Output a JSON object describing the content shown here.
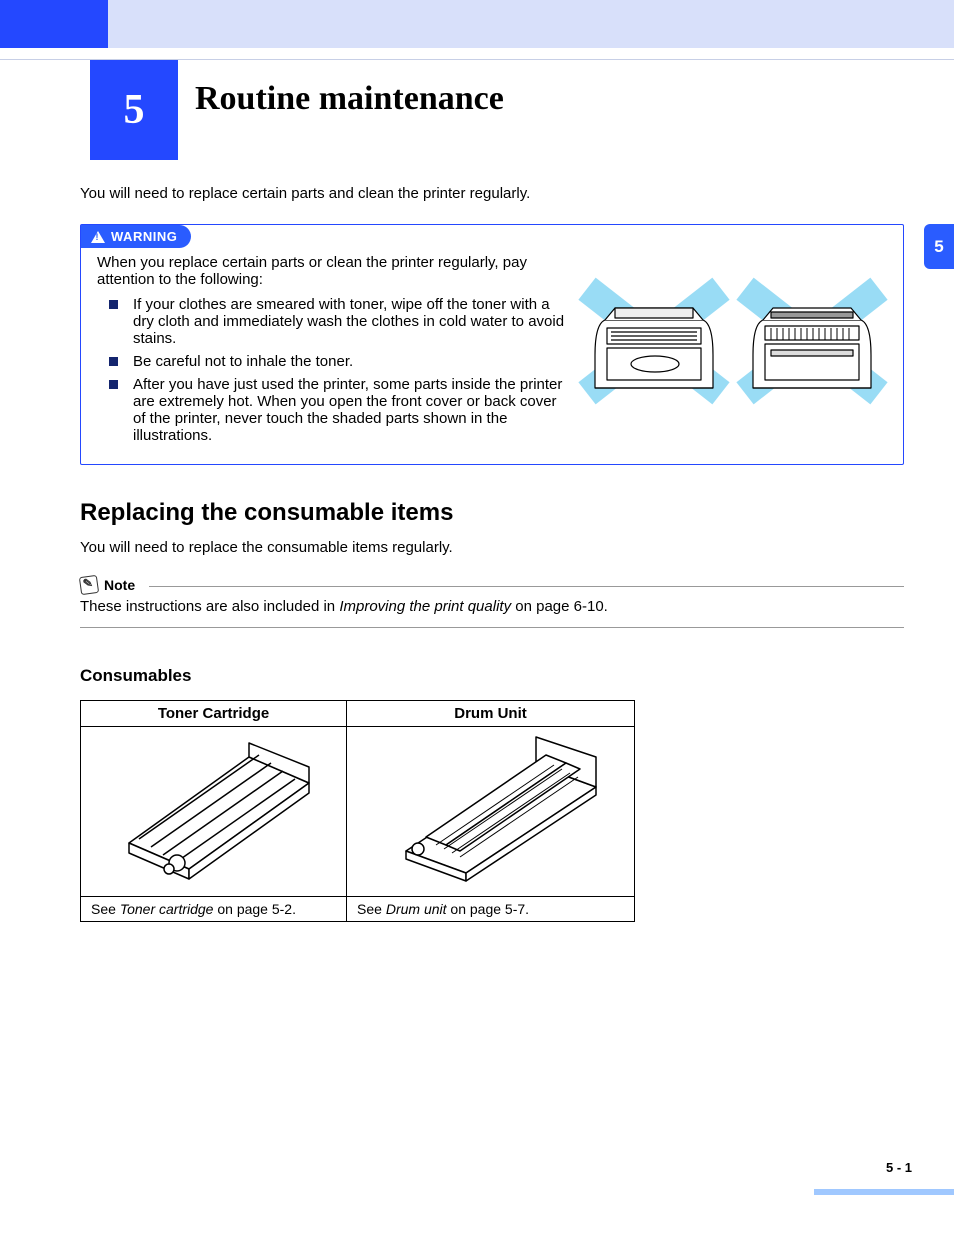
{
  "chapter": {
    "number": "5",
    "title": "Routine maintenance"
  },
  "sideTab": "5",
  "intro": "You will need to replace certain parts and clean the printer regularly.",
  "warning": {
    "label": "WARNING",
    "preamble": "When you replace certain parts or clean the printer regularly, pay attention to the following:",
    "bullets": [
      "If your clothes are smeared with toner, wipe off the toner with a dry cloth and immediately wash the clothes in cold water to avoid stains.",
      "Be careful not to inhale the toner.",
      "After you have just used the printer, some parts inside the printer are extremely hot. When you open the front cover or back cover of the printer, never touch the shaded parts shown in the illustrations."
    ]
  },
  "section": {
    "heading": "Replacing the consumable items",
    "intro": "You will need to replace the consumable items regularly."
  },
  "note": {
    "label": "Note",
    "text_pre": "These instructions are also included in ",
    "text_em": "Improving the print quality",
    "text_post": " on page 6-10."
  },
  "consumables": {
    "heading": "Consumables",
    "cols": [
      {
        "header": "Toner Cartridge",
        "see_pre": "See ",
        "see_em": "Toner cartridge",
        "see_post": " on page 5-2."
      },
      {
        "header": "Drum Unit",
        "see_pre": "See ",
        "see_em": "Drum unit",
        "see_post": " on page 5-7."
      }
    ]
  },
  "pageNumber": "5 - 1"
}
